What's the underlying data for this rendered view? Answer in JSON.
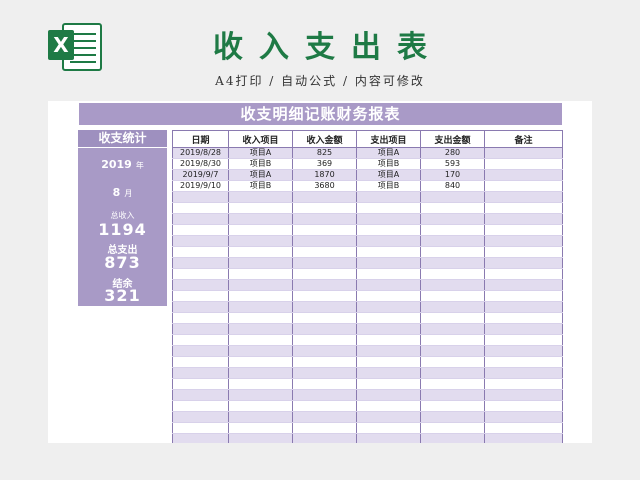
{
  "header": {
    "logo_letter": "X",
    "title": "收入支出表",
    "subtitle": "A4打印 / 自动公式 / 内容可修改"
  },
  "sheet": {
    "banner": "收支明细记账财务报表",
    "stats": {
      "title": "收支统计",
      "year": "2019",
      "year_unit": "年",
      "month": "8",
      "month_unit": "月",
      "income_label": "总收入",
      "income_value": "1194",
      "expense_label": "总支出",
      "expense_value": "873",
      "balance_label": "结余",
      "balance_value": "321"
    },
    "columns": [
      "日期",
      "收入项目",
      "收入金额",
      "支出项目",
      "支出金额",
      "备注"
    ],
    "rows": [
      [
        "2019/8/28",
        "项目A",
        "825",
        "项目A",
        "280",
        ""
      ],
      [
        "2019/8/30",
        "项目B",
        "369",
        "项目B",
        "593",
        ""
      ],
      [
        "2019/9/7",
        "项目A",
        "1870",
        "项目A",
        "170",
        ""
      ],
      [
        "2019/9/10",
        "项目B",
        "3680",
        "项目B",
        "840",
        ""
      ]
    ],
    "empty_row_count": 28
  },
  "colors": {
    "brand_green": "#1e7a45",
    "purple_header": "#a99ac7",
    "row_alt": "#e2dcef"
  }
}
